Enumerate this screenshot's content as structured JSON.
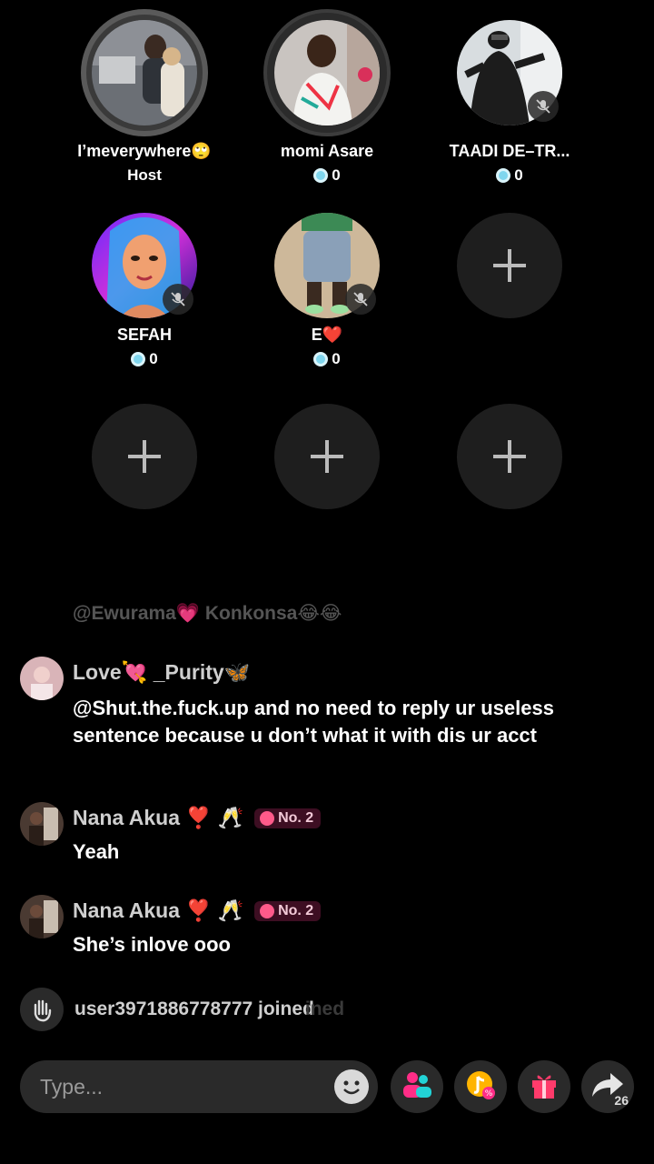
{
  "seats": [
    {
      "name": "I’meverywhere🙄",
      "sub": "Host",
      "is_host": true,
      "muted": false
    },
    {
      "name": "momi Asare",
      "coins": "0",
      "muted": false
    },
    {
      "name": "TAADI DE–TR...",
      "coins": "0",
      "muted": true
    },
    {
      "name": "SEFAH",
      "coins": "0",
      "muted": true
    },
    {
      "name": "E❤️",
      "coins": "0",
      "muted": true
    }
  ],
  "empty_seat_icon": "plus-icon",
  "chat": {
    "faded_line": "@Ewurama💗  Konkonsa😂😂",
    "messages": [
      {
        "user": "Love💘 _Purity🦋",
        "text": "@Shut.the.fuck.up and no need to reply ur useless sentence because u don’t what it with dis ur acct"
      },
      {
        "user": "Nana Akua ❣️ 🥂",
        "badge": "No. 2",
        "text": "Yeah"
      },
      {
        "user": "Nana Akua ❣️ 🥂",
        "badge": "No. 2",
        "text": "She’s inlove ooo"
      }
    ],
    "joined": "user3971886778777 joined",
    "joined_ghost": "ined"
  },
  "bottom_bar": {
    "placeholder": "Type...",
    "share_count": "26"
  },
  "colors": {
    "background": "#000000",
    "badge_bg": "#3d0e22",
    "gift": "#ff3b6b",
    "people": "#ff2d87"
  }
}
